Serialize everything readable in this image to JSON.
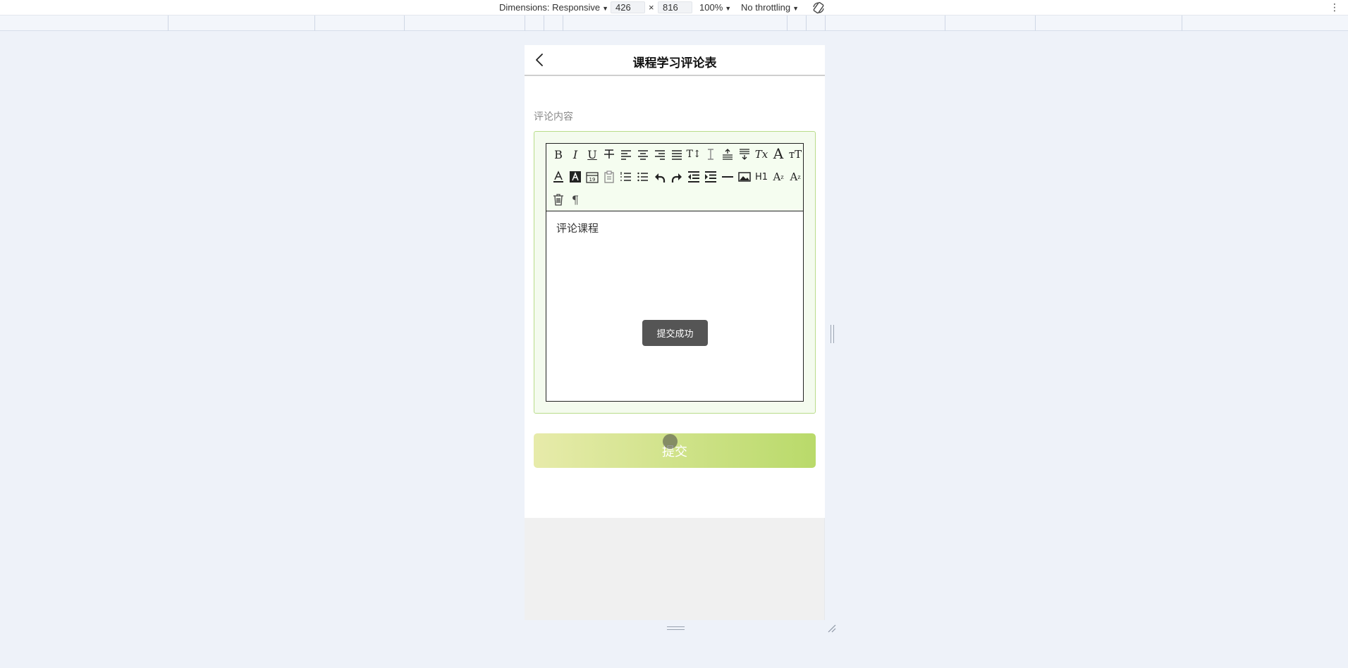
{
  "devtools": {
    "dimensions_label": "Dimensions: Responsive",
    "width_value": "426",
    "times_sign": "×",
    "height_value": "816",
    "zoom": "100%",
    "throttling": "No throttling"
  },
  "app": {
    "title": "课程学习评论表",
    "field_label": "评论内容",
    "editor_content": "评论课程",
    "toast": "提交成功",
    "submit_label": "提交"
  },
  "toolbar_icons": [
    "bold",
    "italic",
    "underline",
    "strikethrough",
    "align-left",
    "align-center",
    "align-right",
    "align-justify",
    "font-size",
    "line-height",
    "indent-before",
    "indent-after",
    "clear-format",
    "font-family",
    "text-size",
    "font-color",
    "background-color",
    "date",
    "paste",
    "ordered-list",
    "unordered-list",
    "undo",
    "redo",
    "outdent",
    "indent",
    "horizontal-rule",
    "image",
    "heading",
    "subscript",
    "superscript",
    "delete",
    "paragraph"
  ],
  "colors": {
    "page_bg": "#eef2f9",
    "editor_border": "#b9dc8a",
    "submit_gradient_start": "#e7ebaa",
    "submit_gradient_end": "#b9da6a",
    "toast_bg": "#555555"
  }
}
